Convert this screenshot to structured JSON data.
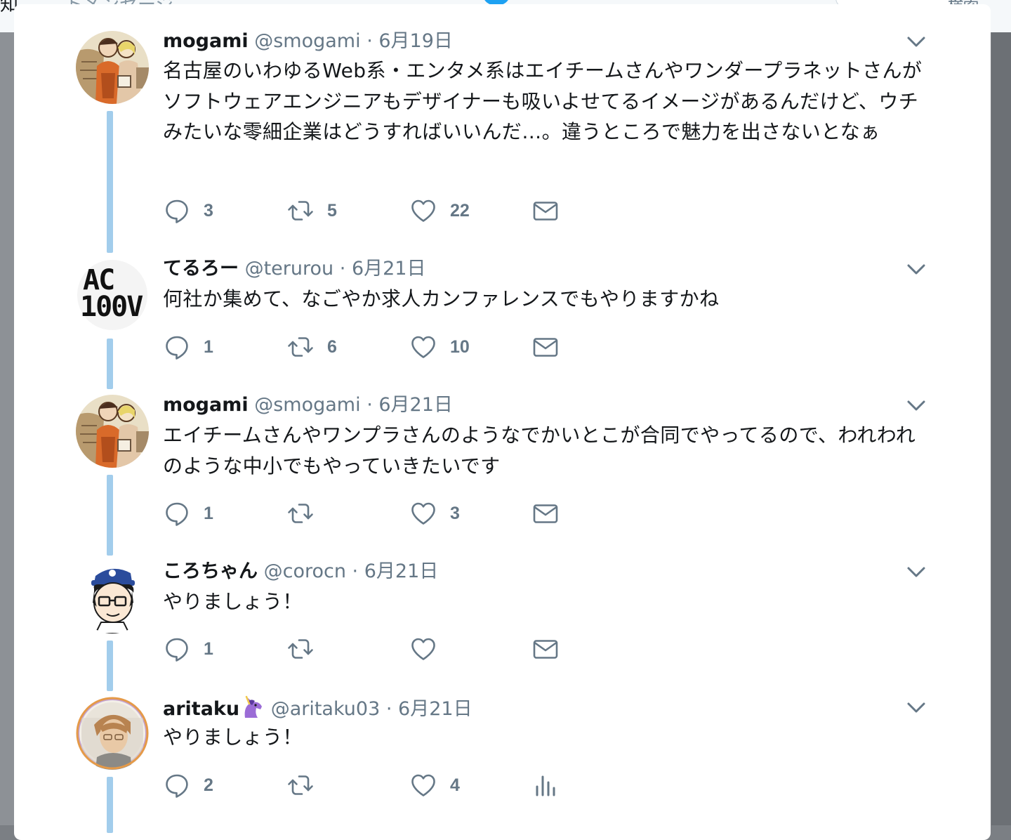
{
  "background": {
    "frag_left": "知",
    "frag_mid": "トメンセージ",
    "frag_right": "検索"
  },
  "colors": {
    "accent": "#1da1f2",
    "thread": "#a2cdec",
    "meta": "#657786",
    "text": "#14171a"
  },
  "tweets": [
    {
      "name": "mogami",
      "handle": "@smogami",
      "sep": "·",
      "date": "6月19日",
      "text": "名古屋のいわゆるWeb系・エンタメ系はエイチームさんやワンダープラネットさんがソフトウェアエンジニアもデザイナーも吸いよせてるイメージがあるんだけど、ウチみたいな零細企業はどうすればいいんだ…。違うところで魅力を出さないとなぁ",
      "avatar_icon": "mogami-avatar",
      "replies": "3",
      "retweets": "5",
      "likes": "22",
      "last_action_icon": "envelope-icon"
    },
    {
      "name": "てるろー",
      "handle": "@terurou",
      "sep": "·",
      "date": "6月21日",
      "text": "何社か集めて、なごやか求人カンファレンスでもやりますかね",
      "avatar_icon": "ac100v-avatar",
      "avatar_text_top": "AC",
      "avatar_text_bottom": "100V",
      "replies": "1",
      "retweets": "6",
      "likes": "10",
      "last_action_icon": "envelope-icon"
    },
    {
      "name": "mogami",
      "handle": "@smogami",
      "sep": "·",
      "date": "6月21日",
      "text": "エイチームさんやワンプラさんのようなでかいとこが合同でやってるので、われわれのような中小でもやっていきたいです",
      "avatar_icon": "mogami-avatar",
      "replies": "1",
      "retweets": "",
      "likes": "3",
      "last_action_icon": "envelope-icon"
    },
    {
      "name": "ころちゃん",
      "handle": "@corocn",
      "sep": "·",
      "date": "6月21日",
      "text": "やりましょう！",
      "avatar_icon": "corocn-avatar",
      "replies": "1",
      "retweets": "",
      "likes": "",
      "last_action_icon": "envelope-icon"
    },
    {
      "name": "aritaku",
      "handle": "@aritaku03",
      "sep": "·",
      "date": "6月21日",
      "name_emoji": "unicorn-emoji",
      "text": "やりましょう！",
      "avatar_icon": "aritaku-avatar",
      "replies": "2",
      "retweets": "",
      "likes": "4",
      "last_action_icon": "analytics-icon"
    }
  ]
}
